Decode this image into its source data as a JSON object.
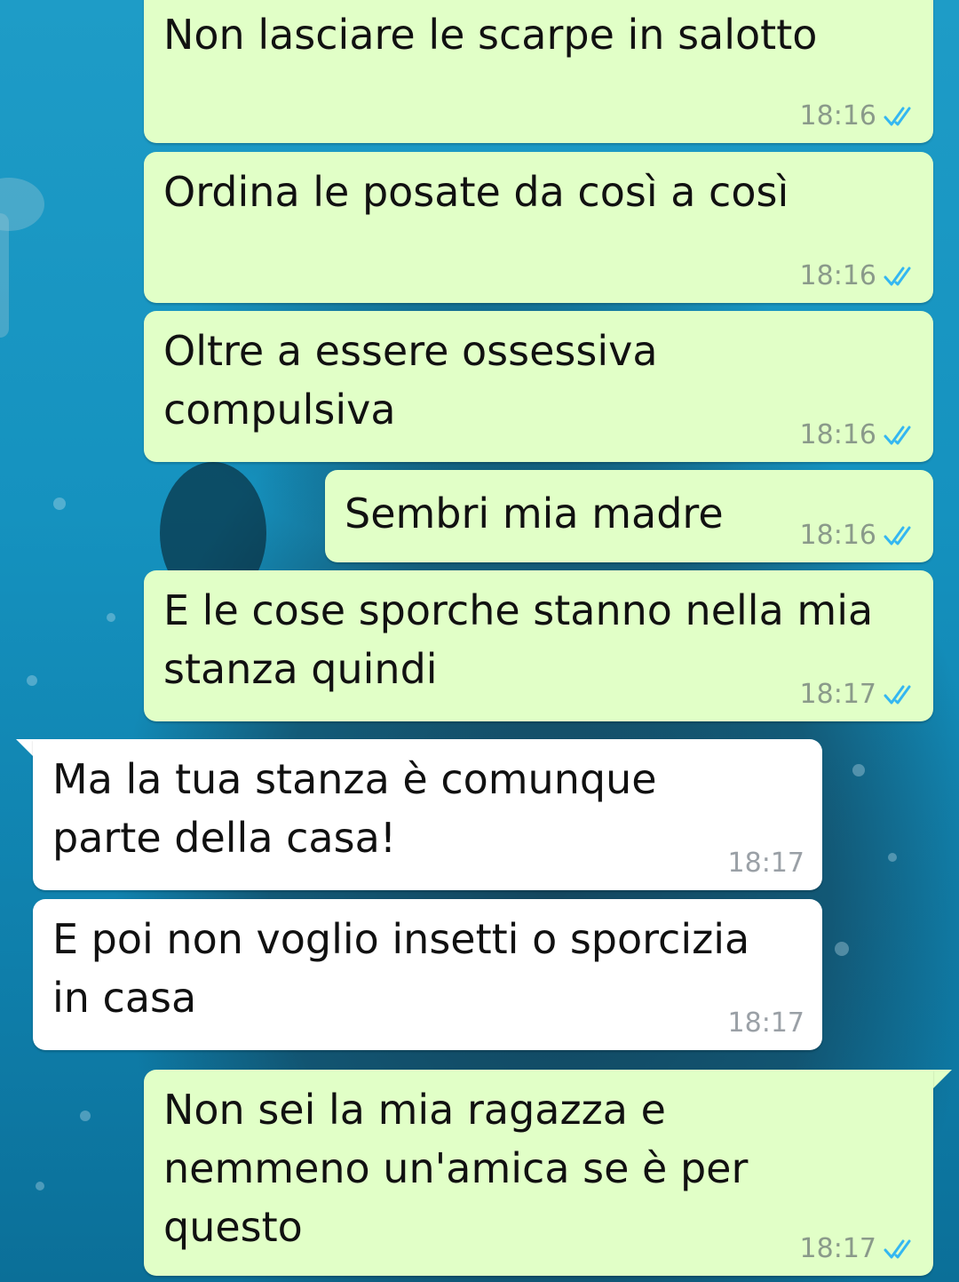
{
  "colors": {
    "outgoing_bubble": "#e1ffc7",
    "incoming_bubble": "#ffffff",
    "read_ticks": "#34b7f1",
    "timestamp": "#8a9a8a"
  },
  "messages": [
    {
      "direction": "outgoing",
      "text": "Non lasciare le scarpe in salotto",
      "time": "18:16",
      "status": "read"
    },
    {
      "direction": "outgoing",
      "text": "Ordina le posate da così a così",
      "time": "18:16",
      "status": "read"
    },
    {
      "direction": "outgoing",
      "text": "Oltre a essere ossessiva compulsiva",
      "time": "18:16",
      "status": "read"
    },
    {
      "direction": "outgoing",
      "text": "Sembri mia madre",
      "time": "18:16",
      "status": "read"
    },
    {
      "direction": "outgoing",
      "text": "E le cose sporche stanno nella mia stanza quindi",
      "time": "18:17",
      "status": "read"
    },
    {
      "direction": "incoming",
      "text": "Ma la tua stanza è comunque parte della casa!",
      "time": "18:17"
    },
    {
      "direction": "incoming",
      "text": "E poi non voglio insetti o sporcizia in casa",
      "time": "18:17"
    },
    {
      "direction": "outgoing",
      "text": "Non sei la mia ragazza e nemmeno un'amica se è per questo",
      "time": "18:17",
      "status": "read"
    }
  ],
  "icons": {
    "read_receipt": "double-check-icon"
  }
}
